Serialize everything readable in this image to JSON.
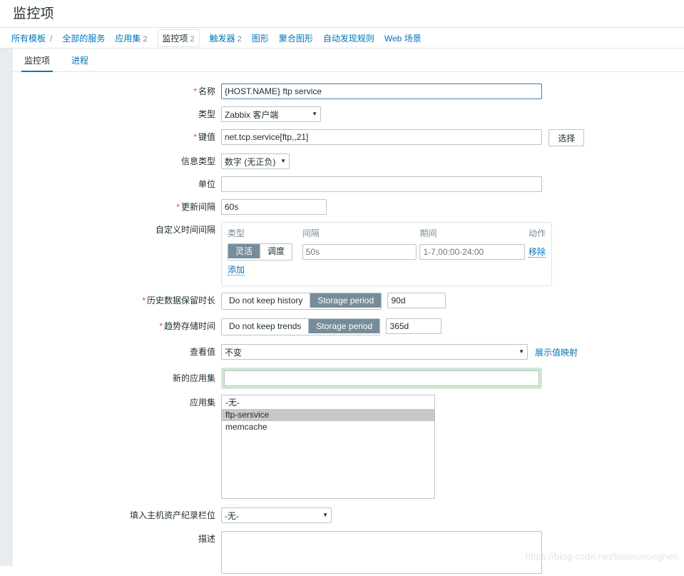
{
  "page": {
    "title": "监控项",
    "watermark": "https://blog.csdn.net/liaowunonghen"
  },
  "breadcrumb": {
    "items": [
      {
        "label": "所有模板",
        "count": "",
        "active": false
      },
      {
        "label": "全部的服务",
        "count": "",
        "active": false
      },
      {
        "label": "应用集",
        "count": "2",
        "active": false
      },
      {
        "label": "监控项",
        "count": "2",
        "active": true
      },
      {
        "label": "触发器",
        "count": "2",
        "active": false
      },
      {
        "label": "图形",
        "count": "",
        "active": false
      },
      {
        "label": "聚合图形",
        "count": "",
        "active": false
      },
      {
        "label": "自动发现规则",
        "count": "",
        "active": false
      },
      {
        "label": "Web 场景",
        "count": "",
        "active": false
      }
    ],
    "separator": "/"
  },
  "subtabs": [
    {
      "label": "监控项",
      "active": true
    },
    {
      "label": "进程",
      "active": false
    }
  ],
  "form": {
    "name": {
      "label": "名称",
      "required": true,
      "value": "{HOST.NAME} ftp service",
      "placeholder": ""
    },
    "type": {
      "label": "类型",
      "required": false,
      "value": "Zabbix 客户端"
    },
    "key": {
      "label": "键值",
      "required": true,
      "value": "net.tcp.service[ftp,,21]",
      "placeholder": "",
      "select_button": "选择"
    },
    "value_type": {
      "label": "信息类型",
      "required": false,
      "value": "数字 (无正负)"
    },
    "units": {
      "label": "单位",
      "required": false,
      "value": "",
      "placeholder": ""
    },
    "update_interval": {
      "label": "更新间隔",
      "required": true,
      "value": "60s",
      "placeholder": ""
    },
    "custom_intervals": {
      "label": "自定义时间间隔",
      "headers": {
        "type": "类型",
        "interval": "间隔",
        "period": "期间",
        "action": "动作"
      },
      "rows": [
        {
          "type_options": [
            "灵活",
            "调度"
          ],
          "type_selected": "灵活",
          "interval_value": "",
          "interval_placeholder": "50s",
          "period_value": "",
          "period_placeholder": "1-7,00:00-24:00",
          "remove_label": "移除"
        }
      ],
      "add_label": "添加"
    },
    "history": {
      "label": "历史数据保留时长",
      "required": true,
      "options": [
        "Do not keep history",
        "Storage period"
      ],
      "selected": "Storage period",
      "value": "90d"
    },
    "trends": {
      "label": "趋势存储时间",
      "required": true,
      "options": [
        "Do not keep trends",
        "Storage period"
      ],
      "selected": "Storage period",
      "value": "365d"
    },
    "value_mapping": {
      "label": "查看值",
      "required": false,
      "value": "不变",
      "link_label": "展示值映射"
    },
    "new_application": {
      "label": "新的应用集",
      "required": false,
      "value": "",
      "placeholder": "",
      "highlight_color": "#cfe8d2"
    },
    "applications": {
      "label": "应用集",
      "options": [
        {
          "label": "-无-",
          "selected": false
        },
        {
          "label": "ftp-sersvice",
          "selected": true
        },
        {
          "label": "memcache",
          "selected": false
        }
      ]
    },
    "inventory_field": {
      "label": "填入主机资产纪录栏位",
      "required": false,
      "value": "-无-"
    },
    "description": {
      "label": "描述",
      "required": false,
      "value": "",
      "placeholder": ""
    }
  },
  "colors": {
    "accent": "#0275b8",
    "toggle_on": "#768d99",
    "required_star": "#d64e4e",
    "border": "#b8c4cb"
  }
}
